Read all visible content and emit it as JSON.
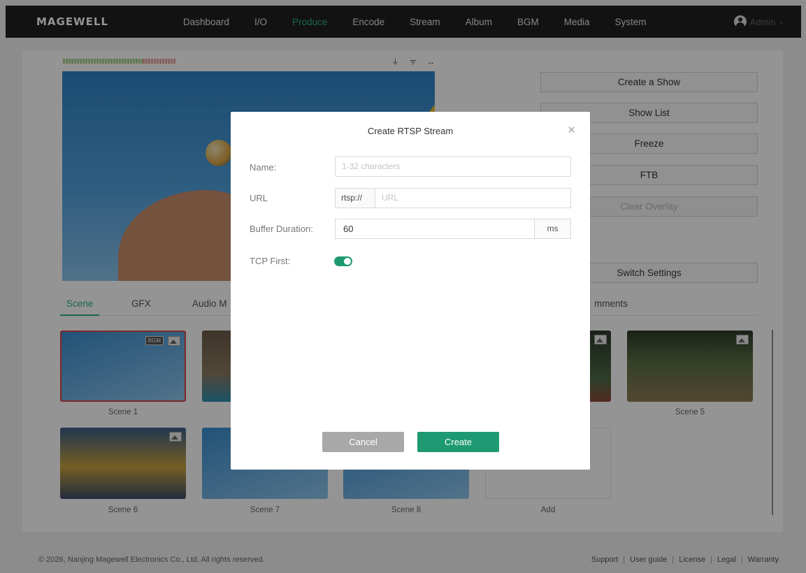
{
  "brand": "MAGEWELL",
  "nav": {
    "items": [
      "Dashboard",
      "I/O",
      "Produce",
      "Encode",
      "Stream",
      "Album",
      "BGM",
      "Media",
      "System"
    ],
    "active": "Produce"
  },
  "user": {
    "name": "Admin"
  },
  "status_icons": "⏚ ᯤ ↔",
  "actions": {
    "create_show": "Create a Show",
    "show_list": "Show List",
    "freeze": "Freeze",
    "ftb": "FTB",
    "clear_overlay": "Clear Overlay",
    "switch_settings": "Switch Settings"
  },
  "tabs": [
    "Scene",
    "GFX",
    "Audio M",
    "mments"
  ],
  "scenes": [
    {
      "label": "Scene 1",
      "bgm_badge": "BGM"
    },
    {
      "label": "Scene 5"
    },
    {
      "label": "Scene 6"
    },
    {
      "label": "Scene 7"
    },
    {
      "label": "Scene 8"
    },
    {
      "label": "Add"
    }
  ],
  "footer": {
    "copyright": "© 2026, Nanjing Magewell Electronics Co., Ltd. All rights reserved.",
    "links": [
      "Support",
      "User guide",
      "License",
      "Legal",
      "Warranty"
    ]
  },
  "modal": {
    "title": "Create RTSP Stream",
    "close_glyph": "✕",
    "name_label": "Name:",
    "name_placeholder": "1-32 characters",
    "url_label": "URL",
    "url_prefix": "rtsp://",
    "url_placeholder": "URL",
    "buffer_label": "Buffer Duration:",
    "buffer_value": "60",
    "buffer_unit": "ms",
    "tcp_label": "TCP First:",
    "tcp_first": true,
    "cancel": "Cancel",
    "create": "Create"
  },
  "colors": {
    "accent": "#2db087",
    "primary_button": "#1e9a72",
    "topbar": "#1f1f1f",
    "selected_border": "#d94545"
  }
}
